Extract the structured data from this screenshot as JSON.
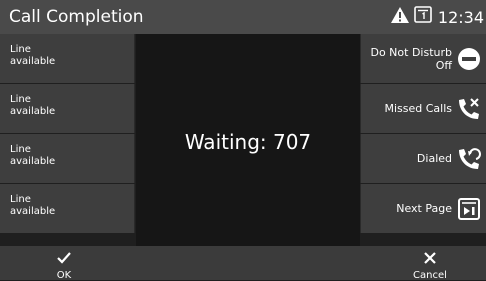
{
  "header": {
    "title": "Call Completion",
    "time": "12:34",
    "icons": [
      "warning-icon",
      "screen-icon"
    ]
  },
  "line_keys": [
    {
      "label": "Line\navailable"
    },
    {
      "label": "Line\navailable"
    },
    {
      "label": "Line\navailable"
    },
    {
      "label": "Line\navailable"
    }
  ],
  "feature_keys": [
    {
      "label": "Do Not Disturb\nOff",
      "icon": "dnd-icon"
    },
    {
      "label": "Missed Calls",
      "icon": "missed-call-icon"
    },
    {
      "label": "Dialed",
      "icon": "dialed-call-icon"
    },
    {
      "label": "Next Page",
      "icon": "next-page-icon"
    }
  ],
  "center": {
    "message": "Waiting: 707"
  },
  "softkeys": {
    "ok_label": "OK",
    "cancel_label": "Cancel"
  },
  "colors": {
    "header_bg": "#4a4a4a",
    "key_bg": "#3e3e3e",
    "center_bg": "#161616",
    "softkey_bg": "#3b3b3b",
    "text": "#ffffff"
  }
}
